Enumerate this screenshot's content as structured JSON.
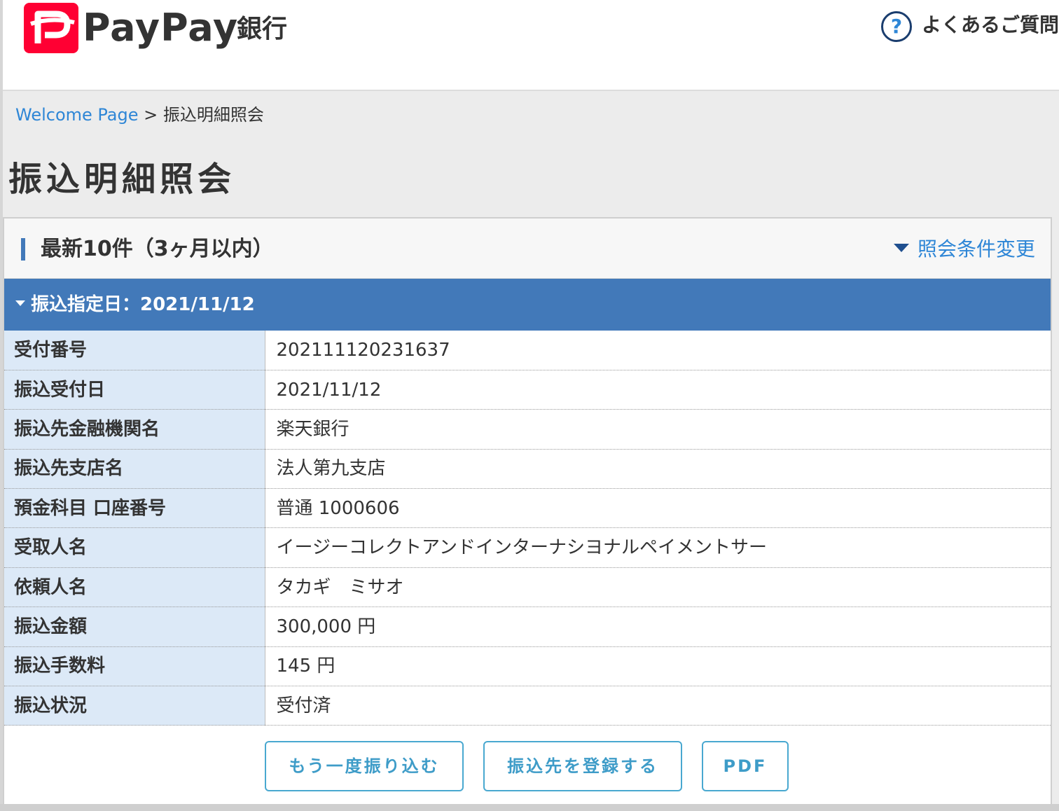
{
  "header": {
    "logo_text": "PayPay",
    "logo_suffix": "銀行",
    "faq_icon_glyph": "?",
    "faq_label": "よくあるご質問"
  },
  "breadcrumb": {
    "home_link": "Welcome Page",
    "separator": ">",
    "current": "振込明細照会"
  },
  "page_title": "振込明細照会",
  "panel": {
    "title": "最新10件（3ヶ月以内）",
    "change_conditions": "照会条件変更",
    "date_header": "振込指定日：2021/11/12"
  },
  "details": [
    {
      "label": "受付番号",
      "value": "202111120231637"
    },
    {
      "label": "振込受付日",
      "value": "2021/11/12"
    },
    {
      "label": "振込先金融機関名",
      "value": "楽天銀行"
    },
    {
      "label": "振込先支店名",
      "value": "法人第九支店"
    },
    {
      "label": "預金科目 口座番号",
      "value": "普通 1000606"
    },
    {
      "label": "受取人名",
      "value": "イージーコレクトアンドインターナシヨナルペイメントサー"
    },
    {
      "label": "依頼人名",
      "value": "タカギ　ミサオ"
    },
    {
      "label": "振込金額",
      "value": "300,000 円"
    },
    {
      "label": "振込手数料",
      "value": "145 円"
    },
    {
      "label": "振込状況",
      "value": "受付済"
    }
  ],
  "buttons": {
    "resend": "もう一度振り込む",
    "register": "振込先を登録する",
    "pdf": "PDF"
  },
  "colors": {
    "brand_red": "#ff0033",
    "accent_blue": "#4279b9",
    "link_blue": "#2e86d6",
    "label_bg": "#dce9f7",
    "button_border": "#49a8d0"
  }
}
